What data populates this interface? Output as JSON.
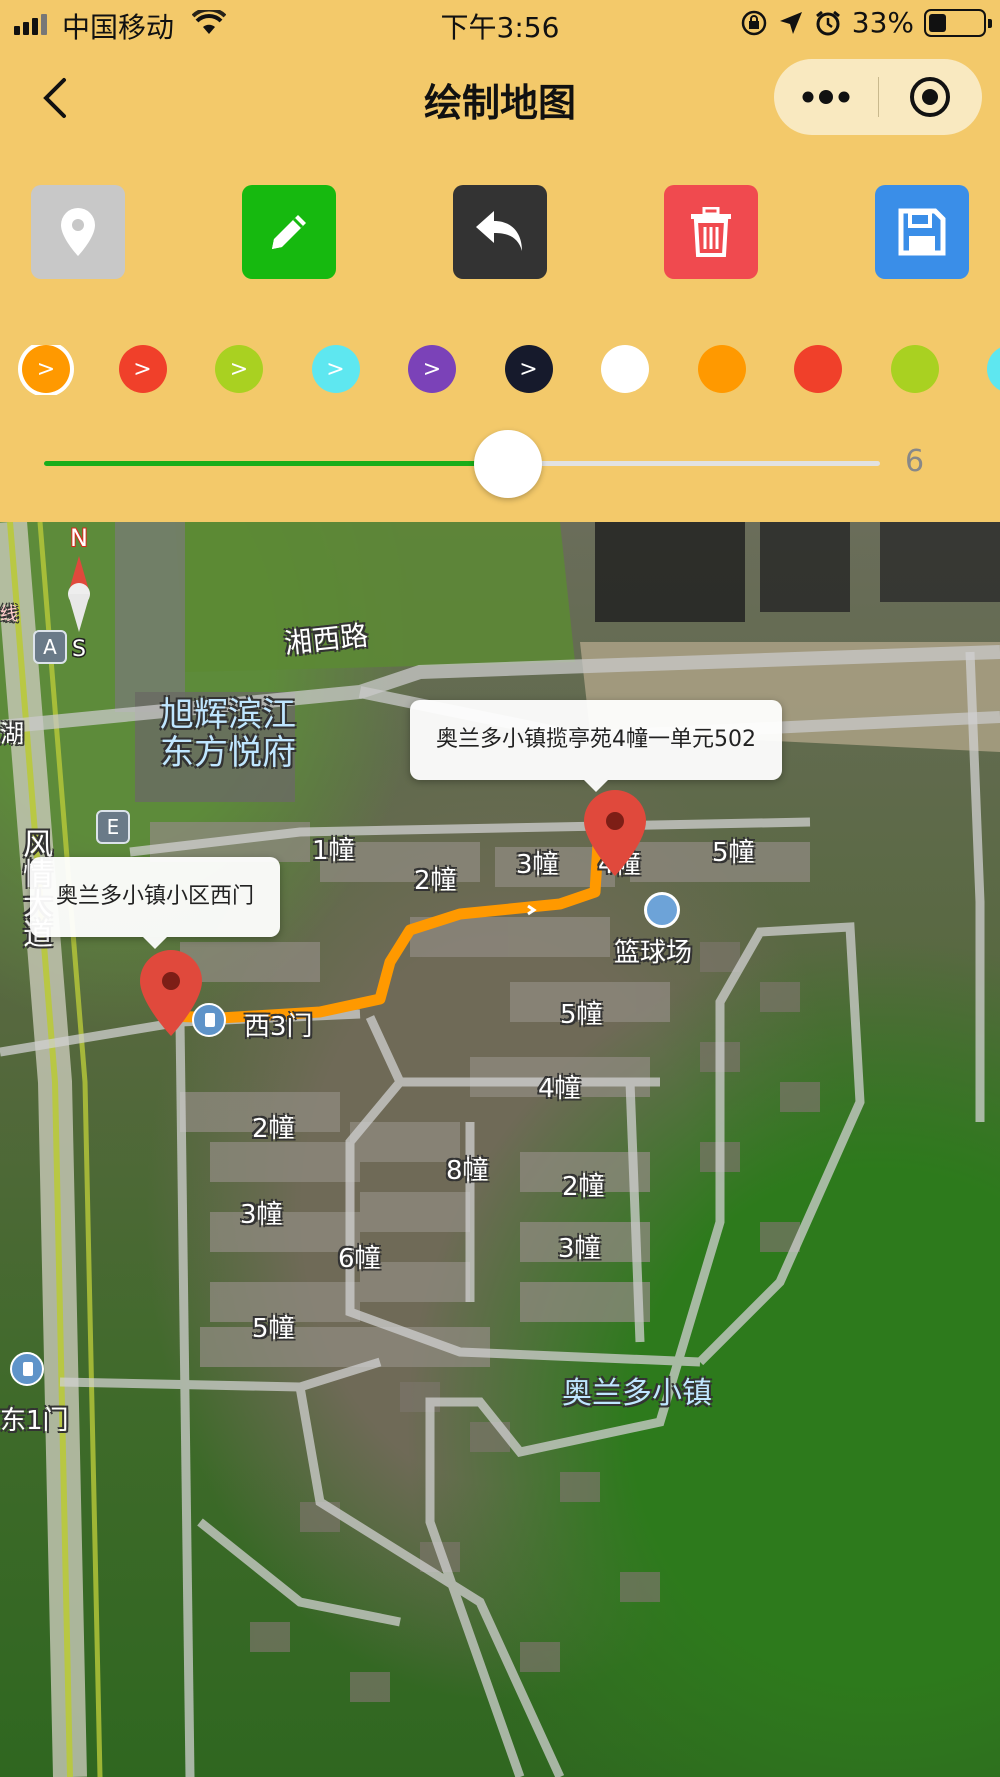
{
  "status_bar": {
    "carrier": "中国移动",
    "time": "下午3:56",
    "battery": "33%",
    "battery_level": 0.33
  },
  "nav": {
    "title": "绘制地图"
  },
  "toolbar": {
    "buttons": [
      {
        "name": "marker",
        "icon": "map-pin-icon",
        "color": "#c8c8c8"
      },
      {
        "name": "draw",
        "icon": "pencil-icon",
        "color": "#16b90f"
      },
      {
        "name": "undo",
        "icon": "undo-icon",
        "color": "#333333"
      },
      {
        "name": "delete",
        "icon": "trash-icon",
        "color": "#f04a4f"
      },
      {
        "name": "save",
        "icon": "save-icon",
        "color": "#3a8ee8"
      }
    ]
  },
  "palette": {
    "swatches": [
      {
        "color": "#ff9900",
        "label": ">",
        "selected": true
      },
      {
        "color": "#f0402a",
        "label": ">"
      },
      {
        "color": "#a9d121",
        "label": ">"
      },
      {
        "color": "#5ee7f0",
        "label": ">"
      },
      {
        "color": "#7b42b8",
        "label": ">"
      },
      {
        "color": "#161a2c",
        "label": ">"
      },
      {
        "color": "#ffffff",
        "label": ""
      },
      {
        "color": "#ff9900",
        "label": ""
      },
      {
        "color": "#f0402a",
        "label": ""
      },
      {
        "color": "#a9d121",
        "label": ""
      },
      {
        "color": "#5ee7f0",
        "label": ""
      }
    ]
  },
  "slider": {
    "value": "6",
    "fraction": 0.555
  },
  "map": {
    "road_label": "湘西路",
    "poi_name_line1": "旭辉滨江",
    "poi_name_line2": "东方悦府",
    "avenue_label": "风情大道",
    "lake_fragment": "湖",
    "red_fragment": "线",
    "callout_end": "奥兰多小镇揽亭苑4幢一单元502",
    "callout_start": "奥兰多小镇小区西门",
    "gate_west3": "西3门",
    "gate_east1": "东1门",
    "court": "篮球场",
    "community": "奥兰多小镇",
    "compass_n": "N",
    "compass_s": "S",
    "badge_a": "A",
    "badge_e": "E",
    "buildings": {
      "b1": "1幢",
      "b2": "2幢",
      "b3": "3幢",
      "b4": "4幢",
      "b5": "5幢",
      "c5": "5幢",
      "c4": "4幢",
      "d2": "2幢",
      "d3": "3幢",
      "d6": "6幢",
      "d5": "5幢",
      "e8": "8幢",
      "e2": "2幢",
      "e3": "3幢"
    },
    "route_color": "#ff9900",
    "pin_color": "#e0493c"
  }
}
